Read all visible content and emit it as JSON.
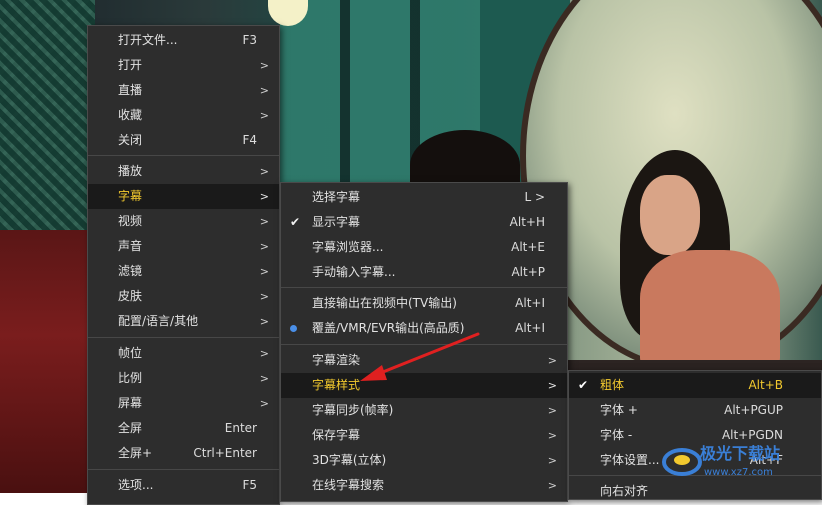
{
  "menu_main": {
    "items": [
      {
        "label": "打开文件...",
        "shortcut": "F3"
      },
      {
        "label": "打开",
        "arrow": ">"
      },
      {
        "label": "直播",
        "arrow": ">"
      },
      {
        "label": "收藏",
        "arrow": ">"
      },
      {
        "label": "关闭",
        "shortcut": "F4"
      },
      {
        "label": "播放",
        "arrow": ">"
      },
      {
        "label": "字幕",
        "arrow": ">"
      },
      {
        "label": "视频",
        "arrow": ">"
      },
      {
        "label": "声音",
        "arrow": ">"
      },
      {
        "label": "滤镜",
        "arrow": ">"
      },
      {
        "label": "皮肤",
        "arrow": ">"
      },
      {
        "label": "配置/语言/其他",
        "arrow": ">"
      },
      {
        "label": "帧位",
        "arrow": ">"
      },
      {
        "label": "比例",
        "arrow": ">"
      },
      {
        "label": "屏幕",
        "arrow": ">"
      },
      {
        "label": "全屏",
        "shortcut": "Enter"
      },
      {
        "label": "全屏+",
        "shortcut": "Ctrl+Enter"
      },
      {
        "label": "选项...",
        "shortcut": "F5"
      }
    ]
  },
  "menu_subtitle": {
    "items": [
      {
        "label": "选择字幕",
        "shortcut": "L >"
      },
      {
        "label": "显示字幕",
        "shortcut": "Alt+H",
        "checked": true
      },
      {
        "label": "字幕浏览器...",
        "shortcut": "Alt+E"
      },
      {
        "label": "手动输入字幕...",
        "shortcut": "Alt+P"
      },
      {
        "label": "直接输出在视频中(TV输出)",
        "shortcut": "Alt+I"
      },
      {
        "label": "覆盖/VMR/EVR输出(高品质)",
        "shortcut": "Alt+I",
        "radio": true
      },
      {
        "label": "字幕渲染",
        "arrow": ">"
      },
      {
        "label": "字幕样式",
        "arrow": ">"
      },
      {
        "label": "字幕同步(帧率)",
        "arrow": ">"
      },
      {
        "label": "保存字幕",
        "arrow": ">"
      },
      {
        "label": "3D字幕(立体)",
        "arrow": ">"
      },
      {
        "label": "在线字幕搜索",
        "arrow": ">"
      }
    ]
  },
  "menu_style": {
    "items": [
      {
        "label": "粗体",
        "shortcut": "Alt+B",
        "checked": true
      },
      {
        "label": "字体 +",
        "shortcut": "Alt+PGUP"
      },
      {
        "label": "字体 -",
        "shortcut": "Alt+PGDN"
      },
      {
        "label": "字体设置...",
        "shortcut": "Alt+F"
      },
      {
        "label": "向右对齐",
        "shortcut": ""
      }
    ]
  },
  "watermark": {
    "text": "极光下载站",
    "url": "www.xz7.com"
  },
  "colors": {
    "highlight_text": "#f2c92e",
    "menu_bg": "#2d2d2d",
    "radio_dot": "#4a8fe8",
    "annotation_arrow": "#e02020"
  }
}
